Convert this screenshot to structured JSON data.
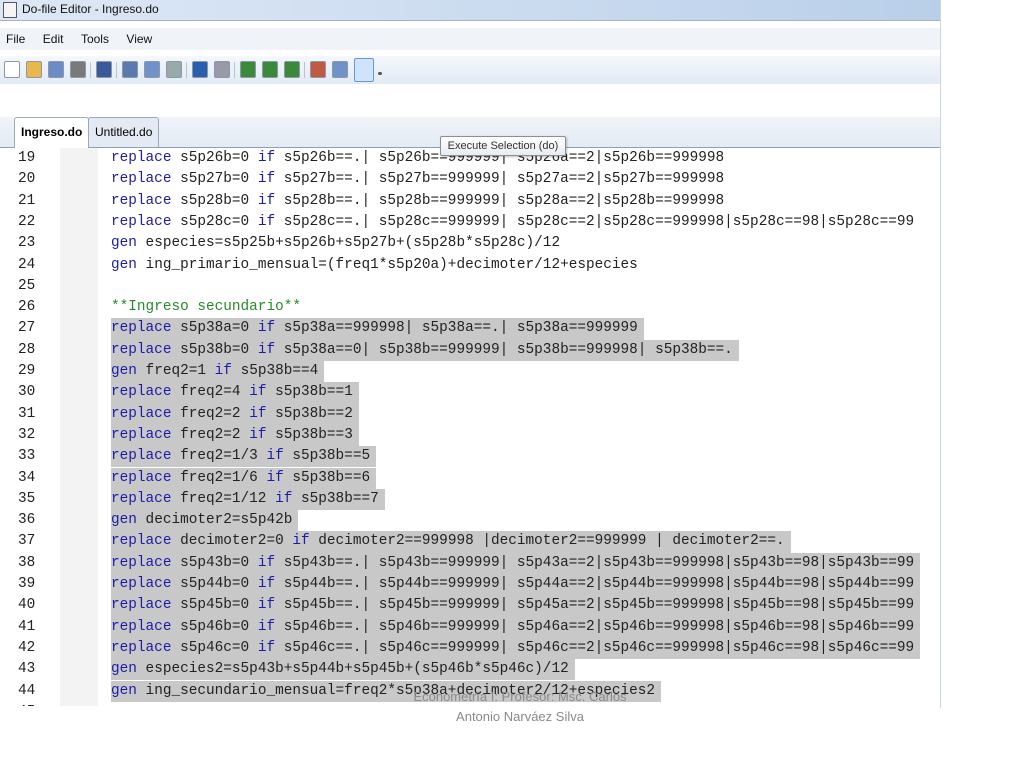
{
  "window": {
    "title": "Do-file Editor - Ingreso.do"
  },
  "menu": [
    "File",
    "Edit",
    "Tools",
    "View"
  ],
  "toolbar": {
    "icons": [
      "new-file-icon",
      "open-icon",
      "save-icon",
      "print-icon",
      "find-icon",
      "cut-icon",
      "copy-icon",
      "paste-icon",
      "undo-icon",
      "redo-icon",
      "shift-right-icon",
      "shift-up-icon",
      "shift-down-icon",
      "bookmark-icon",
      "run-icon",
      "execute-selection-icon",
      "toolbar-overflow-icon"
    ]
  },
  "tabs": [
    {
      "label": "Ingreso.do",
      "active": true
    },
    {
      "label": "Untitled.do",
      "active": false
    }
  ],
  "tooltip": "Execute Selection (do)",
  "colors": {
    "keyword": "#1c1ca8",
    "comment": "#2a8a2a",
    "selection": "#c8c8c8"
  },
  "editor": {
    "first_line": 19,
    "selected_from_line": 27,
    "selected_to_line": 44,
    "lines": [
      "replace s5p26b=0 if s5p26b==.| s5p26b==999999| s5p26a==2|s5p26b==999998",
      "replace s5p27b=0 if s5p27b==.| s5p27b==999999| s5p27a==2|s5p27b==999998",
      "replace s5p28b=0 if s5p28b==.| s5p28b==999999| s5p28a==2|s5p28b==999998",
      "replace s5p28c=0 if s5p28c==.| s5p28c==999999| s5p28c==2|s5p28c==999998|s5p28c==98|s5p28c==99",
      "gen especies=s5p25b+s5p26b+s5p27b+(s5p28b*s5p28c)/12",
      "gen ing_primario_mensual=(freq1*s5p20a)+decimoter/12+especies",
      "",
      "**Ingreso secundario**",
      "replace s5p38a=0 if s5p38a==999998| s5p38a==.| s5p38a==999999",
      "replace s5p38b=0 if s5p38a==0| s5p38b==999999| s5p38b==999998| s5p38b==.",
      "gen freq2=1 if s5p38b==4",
      "replace freq2=4 if s5p38b==1",
      "replace freq2=2 if s5p38b==2",
      "replace freq2=2 if s5p38b==3",
      "replace freq2=1/3 if s5p38b==5",
      "replace freq2=1/6 if s5p38b==6",
      "replace freq2=1/12 if s5p38b==7",
      "gen decimoter2=s5p42b",
      "replace decimoter2=0 if decimoter2==999998 |decimoter2==999999 | decimoter2==.",
      "replace s5p43b=0 if s5p43b==.| s5p43b==999999| s5p43a==2|s5p43b==999998|s5p43b==98|s5p43b==99",
      "replace s5p44b=0 if s5p44b==.| s5p44b==999999| s5p44a==2|s5p44b==999998|s5p44b==98|s5p44b==99",
      "replace s5p45b=0 if s5p45b==.| s5p45b==999999| s5p45a==2|s5p45b==999998|s5p45b==98|s5p45b==99",
      "replace s5p46b=0 if s5p46b==.| s5p46b==999999| s5p46a==2|s5p46b==999998|s5p46b==98|s5p46b==99",
      "replace s5p46c=0 if s5p46c==.| s5p46c==999999| s5p46c==2|s5p46c==999998|s5p46c==98|s5p46c==99",
      "gen especies2=s5p43b+s5p44b+s5p45b+(s5p46b*s5p46c)/12",
      "gen ing_secundario_mensual=freq2*s5p38a+decimoter2/12+especies2",
      ""
    ]
  },
  "footer": {
    "line1": "Econometría I: Profesor: Msc. Carlos",
    "line2": "Antonio Narváez Silva"
  }
}
